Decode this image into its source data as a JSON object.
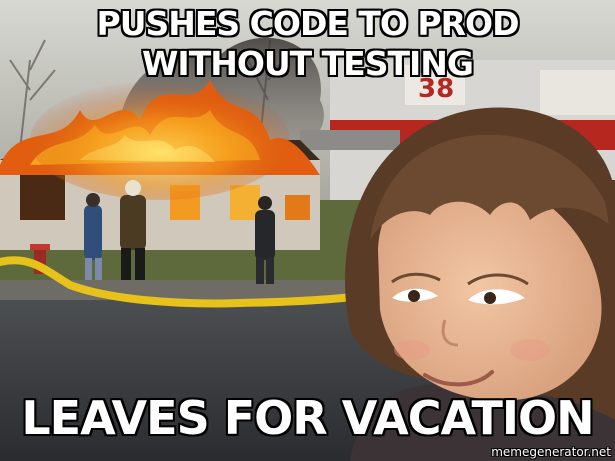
{
  "meme": {
    "top_text": "PUSHES CODE TO PROD WITHOUT TESTING",
    "bottom_text": "LEAVES FOR VACATION",
    "watermark": "memegenerator.net"
  },
  "scene": {
    "truck_number": "38"
  },
  "colors": {
    "fire": "#f07a12",
    "flame_core": "#ffd23a",
    "sky": "#c9c9c4",
    "hose": "#e7c21b",
    "hair": "#6b4a31",
    "skin": "#e9b48f"
  }
}
